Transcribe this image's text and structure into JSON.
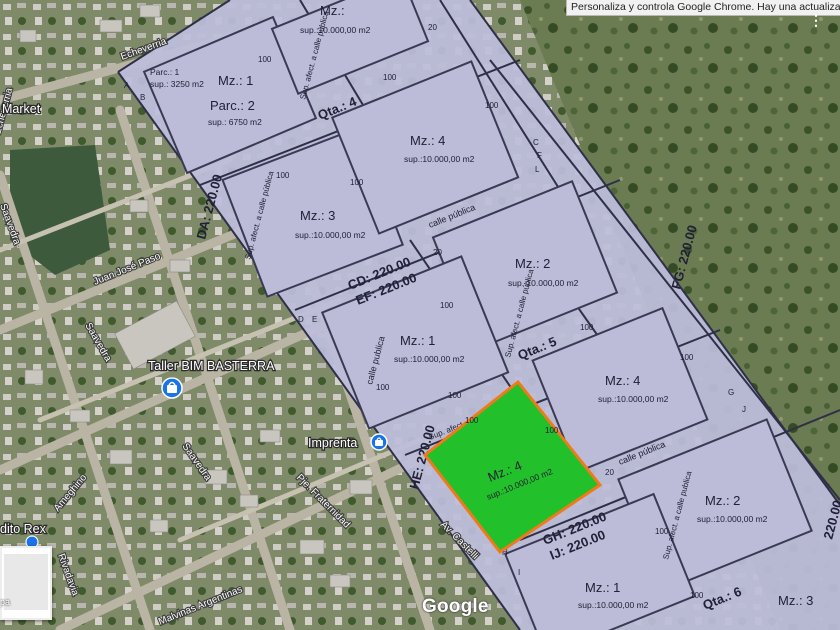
{
  "browser": {
    "tooltip": "Personaliza y controla Google Chrome. Hay una actualización disponible.",
    "menu_icon": "vertical-dots-icon"
  },
  "map": {
    "provider_logo": "Google",
    "layer_toggle_label": "pa",
    "places": [
      {
        "name": "Market"
      },
      {
        "name": "Taller BIM BASTERRA"
      },
      {
        "name": "Imprenta"
      },
      {
        "name": "dito Rex"
      }
    ],
    "streets": [
      {
        "name": "Echeverria"
      },
      {
        "name": "Saavedra"
      },
      {
        "name": "Juan José Paso"
      },
      {
        "name": "Saavedra"
      },
      {
        "name": "Saavedra"
      },
      {
        "name": "Ameghino"
      },
      {
        "name": "Pje. Fraternidad"
      },
      {
        "name": "Av. Castelli"
      },
      {
        "name": "Rivadavia"
      },
      {
        "name": "Malvinas Argentinas"
      },
      {
        "name": "Echeverria"
      }
    ]
  },
  "plat": {
    "blocks": [
      {
        "title": "Mz.: 1",
        "area": ""
      },
      {
        "title": "Parc.: 2",
        "area": "sup.: 6750 m2"
      },
      {
        "title": "Mz.: 3",
        "area": "sup.:10.000,00 m2"
      },
      {
        "title": "Mz.: 4",
        "area": "sup.:10.000,00 m2"
      },
      {
        "title": "Mz.: 2",
        "area": "sup.:10.000,00 m2"
      },
      {
        "title": "Mz.: 1",
        "area": "sup.:10.000,00 m2"
      },
      {
        "title": "Mz.: 4",
        "area": "sup.:10.000,00 m2"
      },
      {
        "title": "Mz.: 4",
        "area": "sup.:10.000,00 m2"
      },
      {
        "title": "Mz.: 2",
        "area": "sup.:10.000,00 m2"
      },
      {
        "title": "Mz.: 1",
        "area": "sup.:10.000,00 m2"
      },
      {
        "title": "Mz.: 2",
        "area": "sup.:10.000,00 m2"
      },
      {
        "title": "Mz.: 3",
        "area": ""
      }
    ],
    "top_block": {
      "title": "Mz.:",
      "area": "sup.:10.000,00 m2"
    },
    "parcel_small": {
      "title": "Parc.: 1",
      "area": "sup.: 3250 m2"
    },
    "fractions": [
      "Qta.: 4",
      "Qta.: 5",
      "Qta.: 6"
    ],
    "dimensions": {
      "da": "DA: 220.00",
      "cd": "CD: 220.00",
      "ef": "EF: 220.00",
      "fg": "FG: 220.00",
      "he": "HE: 220.00",
      "gh": "GH: 220.00",
      "ij": "IJ: 220.00",
      "edge": "220.00",
      "side": "100",
      "corner": "20",
      "thirty": "30"
    },
    "letters": [
      "A",
      "B",
      "C",
      "D",
      "E",
      "F",
      "G",
      "H",
      "I",
      "J",
      "L"
    ],
    "street_note": "calle pública",
    "street_note_b": "calle publica",
    "afect_note": "Sup. afect. a calle pública",
    "afect_note_b": "Sup. afect. a calle publica"
  },
  "selected_parcel": {
    "fill": "#22c02a",
    "border": "#f07a1a",
    "title": "Mz.: 4",
    "area": "sup.:10.000,00 m2"
  },
  "colors": {
    "plat_fill": "#bcbcd8",
    "plat_line": "#2f2f48",
    "vegetation": "#5b6d45"
  }
}
